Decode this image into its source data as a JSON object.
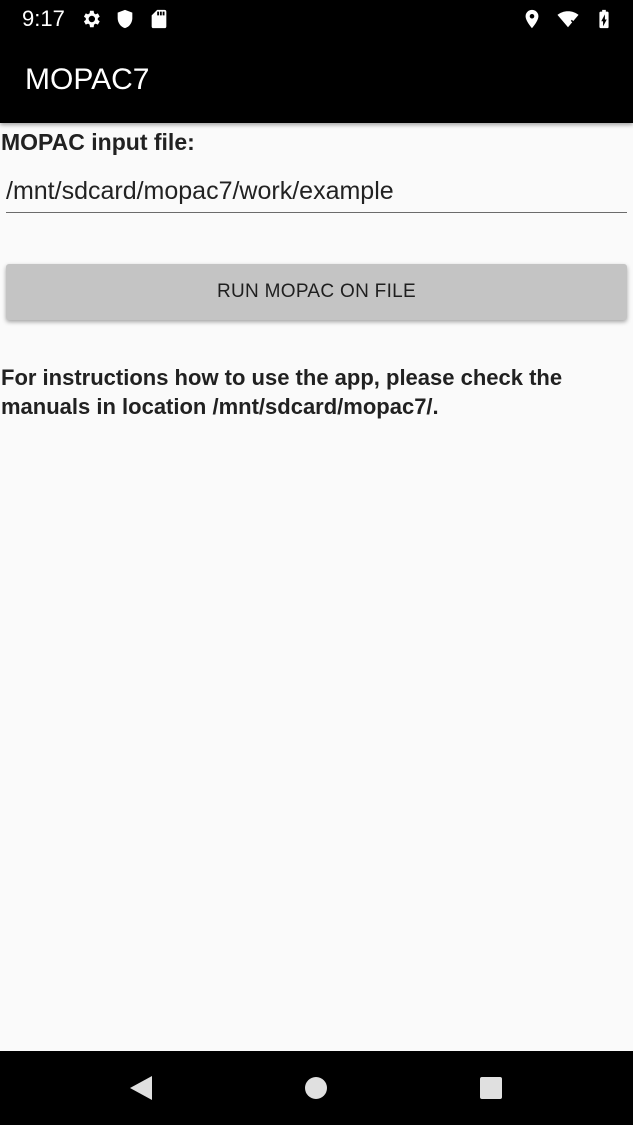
{
  "status_bar": {
    "time": "9:17",
    "left_icons": [
      "settings-icon",
      "shield-icon",
      "sd-card-icon"
    ],
    "right_icons": [
      "location-icon",
      "wifi-icon",
      "battery-charging-icon"
    ]
  },
  "app_bar": {
    "title": "MOPAC7"
  },
  "form": {
    "input_label": "MOPAC input file:",
    "input_value": "/mnt/sdcard/mopac7/work/example",
    "run_button_label": "RUN MOPAC ON FILE"
  },
  "instructions": "For instructions how to use the app, please check the manuals in location /mnt/sdcard/mopac7/.",
  "nav_bar": {
    "buttons": [
      "back-icon",
      "home-icon",
      "recents-icon"
    ]
  },
  "colors": {
    "status_bar_bg": "#000000",
    "app_bar_bg": "#000000",
    "content_bg": "#fafafa",
    "button_bg": "#c4c4c4",
    "text_dark": "#212121"
  }
}
